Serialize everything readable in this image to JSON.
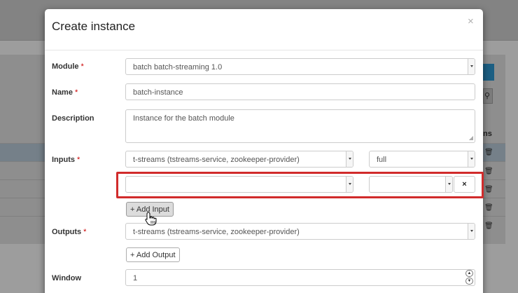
{
  "modal": {
    "title": "Create instance",
    "close": "×",
    "module": {
      "label": "Module",
      "required": "*",
      "value": "batch batch-streaming 1.0"
    },
    "name": {
      "label": "Name",
      "required": "*",
      "value": "batch-instance"
    },
    "description": {
      "label": "Description",
      "value": "Instance for the batch module"
    },
    "inputs": {
      "label": "Inputs",
      "required": "*",
      "rows": [
        {
          "stream": "t-streams (tstreams-service, zookeeper-provider)",
          "mode": "full"
        },
        {
          "stream": "",
          "mode": "",
          "remove": "×"
        }
      ],
      "add_button": "+ Add Input"
    },
    "outputs": {
      "label": "Outputs",
      "required": "*",
      "value": "t-streams (tstreams-service, zookeeper-provider)",
      "add_button": "+ Add Output"
    },
    "window": {
      "label": "Window",
      "value": "1"
    }
  },
  "background": {
    "column_header": "ns"
  },
  "colors": {
    "highlight": "#d12b2b",
    "required": "#cc0000",
    "primary": "#1c5f83"
  },
  "icons": [
    "close-icon",
    "chevron-down-icon",
    "remove-icon",
    "spinner-up-icon",
    "spinner-down-icon",
    "search-icon",
    "trash-icon",
    "pointer-cursor-icon",
    "resize-grip-icon"
  ]
}
